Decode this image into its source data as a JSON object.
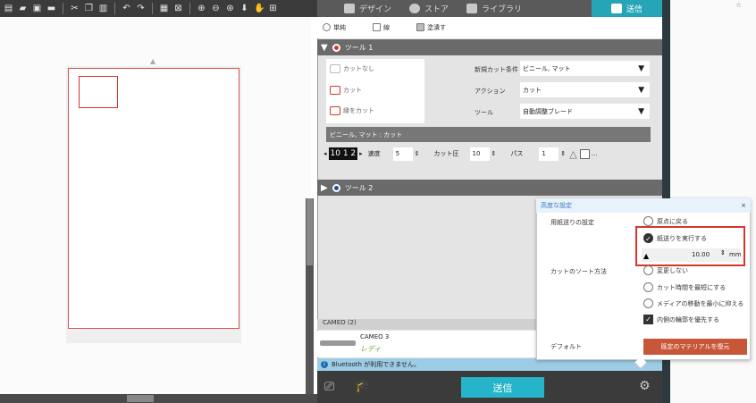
{
  "toolbar": {
    "icons": [
      "new-file-icon",
      "open-icon",
      "save-icon",
      "print-icon",
      "cut-icon",
      "copy-icon",
      "paste-icon",
      "undo-icon",
      "redo-icon",
      "group-icon",
      "ungroup-icon",
      "zoom-in-icon",
      "zoom-out-icon",
      "zoom-fit-icon",
      "move-down-icon",
      "pan-icon",
      "add-page-icon"
    ]
  },
  "nav": {
    "tabs": [
      {
        "label": "デザイン",
        "icon": "grid-icon",
        "active": false
      },
      {
        "label": "ストア",
        "icon": "store-icon",
        "active": false
      },
      {
        "label": "ライブラリ",
        "icon": "library-icon",
        "active": false
      },
      {
        "label": "送信",
        "icon": "send-icon",
        "active": true
      }
    ]
  },
  "panel": {
    "modes": [
      "単純",
      "線",
      "塗潰す"
    ],
    "tool1": {
      "title": "ツール 1",
      "cut_options": [
        "カットなし",
        "カット",
        "縁をカット"
      ],
      "fields": [
        {
          "label": "新規カット条件",
          "value": "ビニール, マット"
        },
        {
          "label": "アクション",
          "value": "カット"
        },
        {
          "label": "ツール",
          "value": "自動調整ブレード"
        }
      ],
      "material_bar": "ビニール, マット : カット",
      "params": {
        "blade": "10 1 2",
        "speed_label": "速度",
        "speed": "5",
        "force_label": "カット圧",
        "force": "10",
        "pass_label": "パス",
        "pass": "1",
        "more": "..."
      }
    },
    "tool2": {
      "title": "ツール 2"
    },
    "devices_header": "CAMEO (2)",
    "device": {
      "name": "CAMEO 3",
      "status": "レディ"
    },
    "info": "Bluetooth が利用できません。",
    "send_button": "送信"
  },
  "popup": {
    "title": "高度な設定",
    "close": "×",
    "feed_label": "用紙送りの設定",
    "feed_options": [
      {
        "label": "原点に戻る",
        "selected": false
      },
      {
        "label": "紙送りを実行する",
        "selected": true
      }
    ],
    "feed_value": "10.00",
    "feed_unit": "mm",
    "sort_label": "カットのソート方法",
    "sort_options": [
      {
        "label": "変更しない",
        "type": "radio",
        "checked": false
      },
      {
        "label": "カット時間を最短にする",
        "type": "radio",
        "checked": false
      },
      {
        "label": "メディアの移動を最小に抑える",
        "type": "radio",
        "checked": false
      },
      {
        "label": "内側の輪郭を優先する",
        "type": "check",
        "checked": true
      }
    ],
    "default_label": "デフォルト",
    "restore_button": "既定のマテリアルを復元"
  },
  "colors": {
    "accent": "#25a5b6",
    "danger": "#d9342b",
    "restore": "#c8573a"
  }
}
